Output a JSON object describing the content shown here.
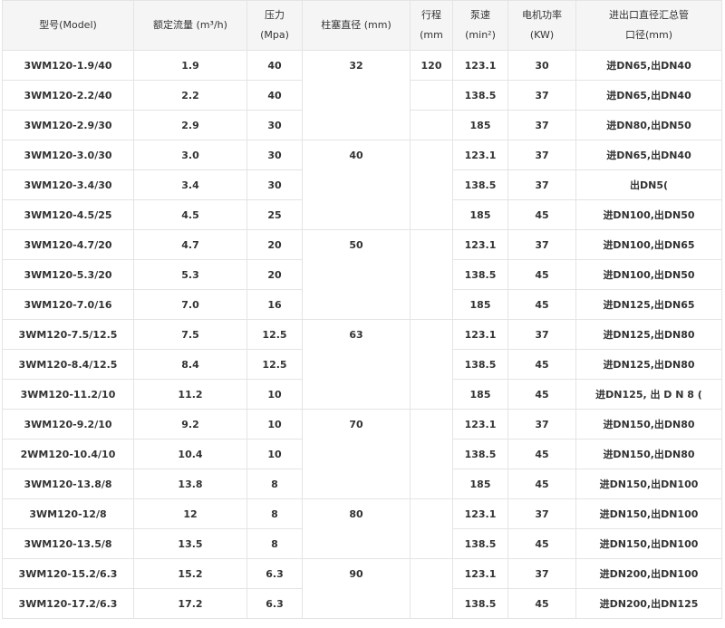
{
  "headers": [
    {
      "line1": "型号(Model)",
      "line2": ""
    },
    {
      "line1": "额定流量 (m³/h)",
      "line2": ""
    },
    {
      "line1": "压力",
      "line2": "(Mpa)"
    },
    {
      "line1": "柱塞直径 (mm)",
      "line2": ""
    },
    {
      "line1": "行程",
      "line2": "(mm"
    },
    {
      "line1": "泵速",
      "line2": "(min²)"
    },
    {
      "line1": "电机功率",
      "line2": "(KW)"
    },
    {
      "line1": "进出口直径汇总管",
      "line2": "口径(mm)"
    }
  ],
  "groups": [
    {
      "diameter": "32",
      "stroke": "120",
      "rows": [
        {
          "model": "3WM120-1.9/40",
          "flow": "1.9",
          "pressure": "40",
          "speed": "123.1",
          "power": "30",
          "ports": "进DN65,出DN40"
        },
        {
          "model": "3WM120-2.2/40",
          "flow": "2.2",
          "pressure": "40",
          "speed": "138.5",
          "power": "37",
          "ports": "进DN65,出DN40"
        },
        {
          "model": "3WM120-2.9/30",
          "flow": "2.9",
          "pressure": "30",
          "speed": "185",
          "power": "37",
          "ports": "进DN80,出DN50"
        }
      ]
    },
    {
      "diameter": "40",
      "stroke": "",
      "rows": [
        {
          "model": "3WM120-3.0/30",
          "flow": "3.0",
          "pressure": "30",
          "speed": "123.1",
          "power": "37",
          "ports": "进DN65,出DN40"
        },
        {
          "model": "3WM120-3.4/30",
          "flow": "3.4",
          "pressure": "30",
          "speed": "138.5",
          "power": "37",
          "ports": "出DN5("
        },
        {
          "model": "3WM120-4.5/25",
          "flow": "4.5",
          "pressure": "25",
          "speed": "185",
          "power": "45",
          "ports": "进DN100,出DN50"
        }
      ]
    },
    {
      "diameter": "50",
      "stroke": "",
      "rows": [
        {
          "model": "3WM120-4.7/20",
          "flow": "4.7",
          "pressure": "20",
          "speed": "123.1",
          "power": "37",
          "ports": "进DN100,出DN65"
        },
        {
          "model": "3WM120-5.3/20",
          "flow": "5.3",
          "pressure": "20",
          "speed": "138.5",
          "power": "45",
          "ports": "进DN100,出DN50"
        },
        {
          "model": "3WM120-7.0/16",
          "flow": "7.0",
          "pressure": "16",
          "speed": "185",
          "power": "45",
          "ports": "进DN125,出DN65"
        }
      ]
    },
    {
      "diameter": "63",
      "stroke": "",
      "rows": [
        {
          "model": "3WM120-7.5/12.5",
          "flow": "7.5",
          "pressure": "12.5",
          "speed": "123.1",
          "power": "37",
          "ports": "进DN125,出DN80"
        },
        {
          "model": "3WM120-8.4/12.5",
          "flow": "8.4",
          "pressure": "12.5",
          "speed": "138.5",
          "power": "45",
          "ports": "进DN125,出DN80"
        },
        {
          "model": "3WM120-11.2/10",
          "flow": "11.2",
          "pressure": "10",
          "speed": "185",
          "power": "45",
          "ports": "进DN125, 出 D N 8 ("
        }
      ]
    },
    {
      "diameter": "70",
      "stroke": "",
      "rows": [
        {
          "model": "3WM120-9.2/10",
          "flow": "9.2",
          "pressure": "10",
          "speed": "123.1",
          "power": "37",
          "ports": "进DN150,出DN80"
        },
        {
          "model": "2WM120-10.4/10",
          "flow": "10.4",
          "pressure": "10",
          "speed": "138.5",
          "power": "45",
          "ports": "进DN150,出DN80"
        },
        {
          "model": "3WM120-13.8/8",
          "flow": "13.8",
          "pressure": "8",
          "speed": "185",
          "power": "45",
          "ports": "进DN150,出DN100"
        }
      ]
    },
    {
      "diameter": "80",
      "stroke": "",
      "rows": [
        {
          "model": "3WM120-12/8",
          "flow": "12",
          "pressure": "8",
          "speed": "123.1",
          "power": "37",
          "ports": "进DN150,出DN100"
        },
        {
          "model": "3WM120-13.5/8",
          "flow": "13.5",
          "pressure": "8",
          "speed": "138.5",
          "power": "45",
          "ports": "进DN150,出DN100"
        }
      ]
    },
    {
      "diameter": "90",
      "stroke": "",
      "rows": [
        {
          "model": "3WM120-15.2/6.3",
          "flow": "15.2",
          "pressure": "6.3",
          "speed": "123.1",
          "power": "37",
          "ports": "进DN200,出DN100"
        },
        {
          "model": "3WM120-17.2/6.3",
          "flow": "17.2",
          "pressure": "6.3",
          "speed": "138.5",
          "power": "45",
          "ports": "进DN200,出DN125"
        }
      ]
    }
  ]
}
